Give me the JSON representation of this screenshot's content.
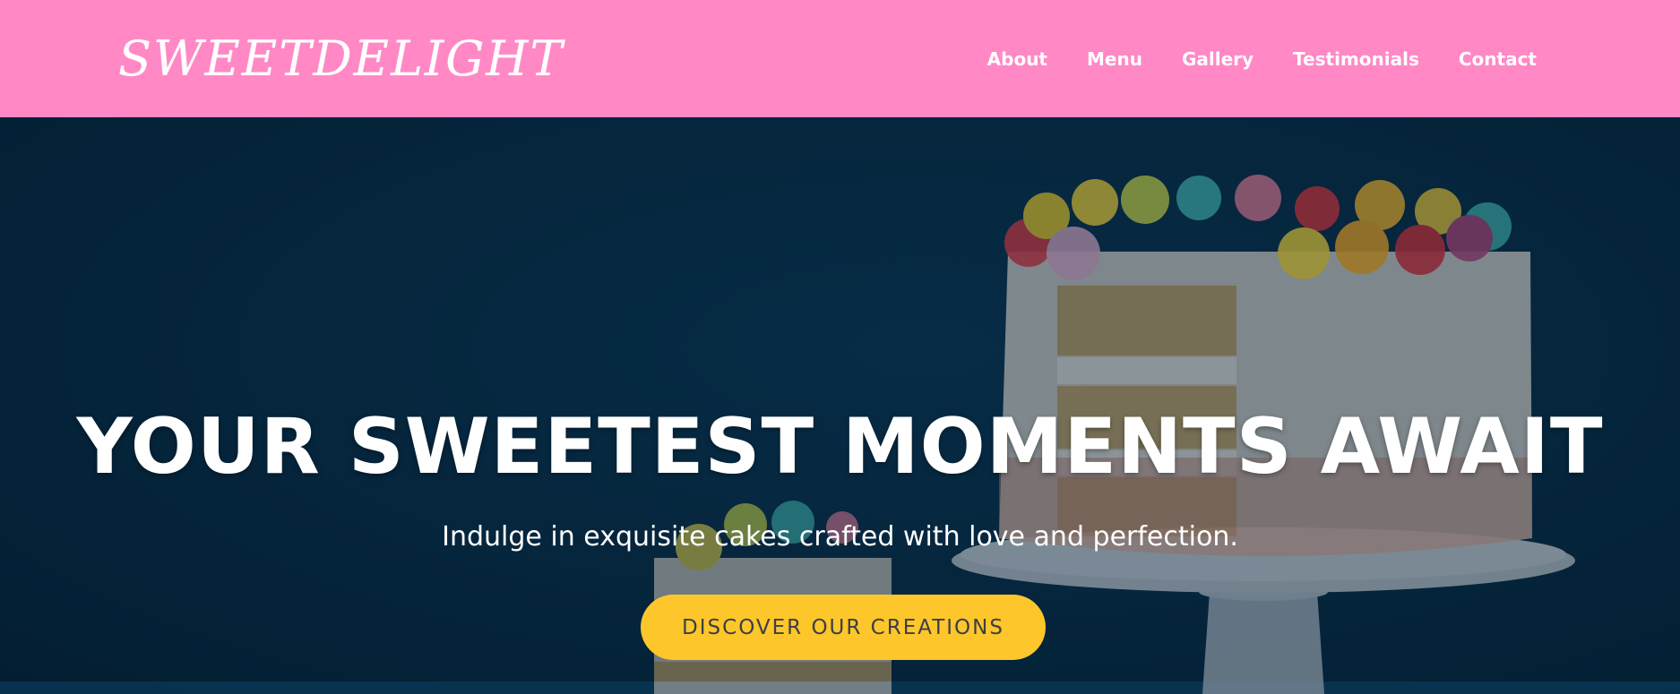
{
  "brand": {
    "logo": "SWEETDELIGHT"
  },
  "nav": {
    "items": [
      {
        "label": "About"
      },
      {
        "label": "Menu"
      },
      {
        "label": "Gallery"
      },
      {
        "label": "Testimonials"
      },
      {
        "label": "Contact"
      }
    ]
  },
  "hero": {
    "title": "YOUR SWEETEST MOMENTS AWAIT",
    "subtitle": "Indulge in exquisite cakes crafted with love and perfection.",
    "cta_label": "DISCOVER OUR CREATIONS"
  },
  "colors": {
    "header_bg": "#ff88c5",
    "hero_bg": "#06283f",
    "cta_bg": "#fdc62b",
    "cta_text": "#3c3f44"
  }
}
